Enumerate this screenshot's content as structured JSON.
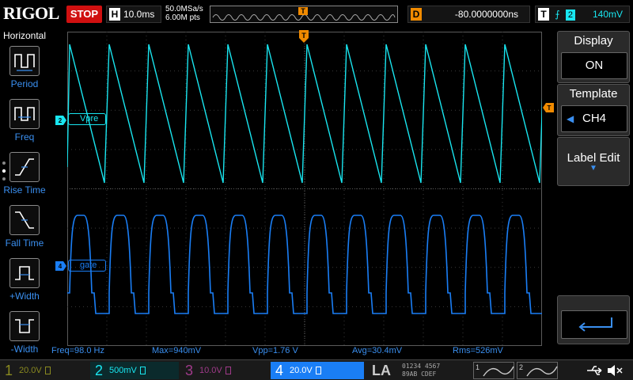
{
  "top": {
    "logo": "RIGOL",
    "status": "STOP",
    "horizontal": {
      "label": "H",
      "value": "10.0ms"
    },
    "sample_rate": "50.0MSa/s",
    "memory_depth": "6.00M pts",
    "trigger_marker": "T",
    "delay": {
      "label": "D",
      "value": "-80.0000000ns"
    },
    "trigger": {
      "label": "T",
      "edge": "rising-edge-icon",
      "source": "2",
      "level": "140mV"
    }
  },
  "left_menu": {
    "title": "Horizontal",
    "items": [
      {
        "label": "Period",
        "icon": "period-icon"
      },
      {
        "label": "Freq",
        "icon": "freq-icon"
      },
      {
        "label": "Rise Time",
        "icon": "rise-time-icon"
      },
      {
        "label": "Fall Time",
        "icon": "fall-time-icon"
      },
      {
        "label": "+Width",
        "icon": "positive-width-icon"
      },
      {
        "label": "-Width",
        "icon": "negative-width-icon"
      }
    ]
  },
  "right_menu": {
    "display": {
      "label": "Display",
      "value": "ON"
    },
    "template": {
      "label": "Template",
      "value": "CH4"
    },
    "label_edit": {
      "label": "Label Edit"
    },
    "enter_icon": "enter-icon"
  },
  "channels_on_screen": {
    "ch2": {
      "marker": "2",
      "label": "Vpre",
      "color": "#19e6f0"
    },
    "ch4": {
      "marker": "4",
      "label": "gate",
      "color": "#1a7ef5"
    }
  },
  "measurements": {
    "freq": "Freq=98.0 Hz",
    "max": "Max=940mV",
    "vpp": "Vpp=1.76 V",
    "avg": "Avg=30.4mV",
    "rms": "Rms=526mV"
  },
  "channel_bar": {
    "ch1": {
      "num": "1",
      "value": "20.0V",
      "color": "#8a8a20"
    },
    "ch2": {
      "num": "2",
      "value": "500mV",
      "color": "#19e6f0"
    },
    "ch3": {
      "num": "3",
      "value": "10.0V",
      "color": "#a03a8a"
    },
    "ch4": {
      "num": "4",
      "value": "20.0V",
      "color": "#1a7ef5"
    },
    "la": "LA",
    "digital_groups": [
      "01234",
      "4567",
      "89AB",
      "CDEF"
    ],
    "math1": "1",
    "math2": "2"
  },
  "waveforms": {
    "ch2_sawtooth": {
      "periods_on_screen": 12,
      "shape": "sawtooth"
    },
    "ch4_pulse": {
      "periods_on_screen": 12,
      "shape": "rounded-pulse"
    }
  },
  "colors": {
    "stop": "#d01010",
    "accent_orange": "#f08a00",
    "menu_blue": "#3a8ff0"
  }
}
